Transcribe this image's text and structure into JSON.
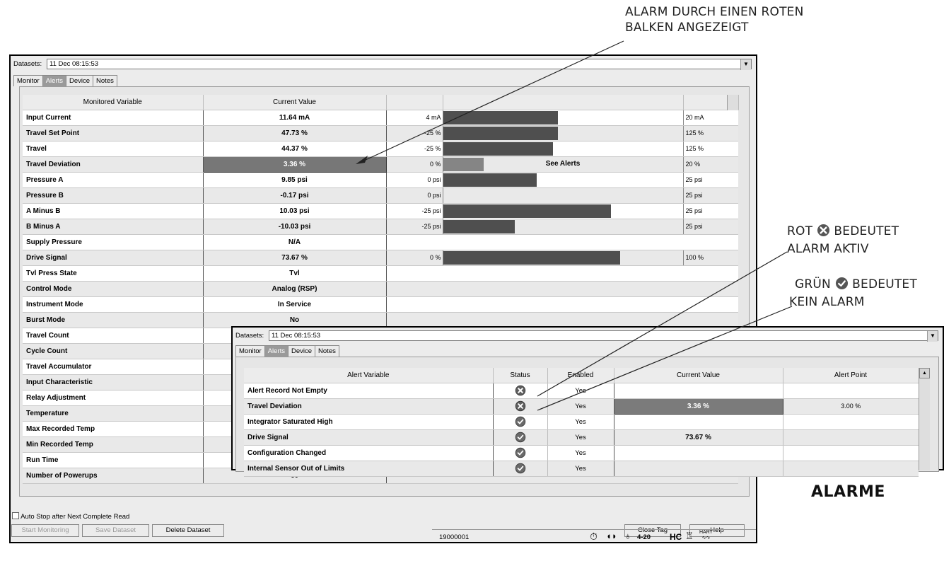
{
  "callouts": {
    "top": [
      "ALARM DURCH EINEN ROTEN",
      "BALKEN ANGEZEIGT"
    ],
    "red": {
      "pre": "ROT",
      "post": "BEDEUTET",
      "line2": "ALARM AKTIV"
    },
    "green": {
      "pre": "GRÜN",
      "post": "BEDEUTET",
      "line2": "KEIN ALARM"
    },
    "title": "ALARME"
  },
  "monitor": {
    "datasets_label": "Datasets:",
    "dataset_value": "11 Dec  08:15:53",
    "tabs": [
      "Monitor",
      "Alerts",
      "Device",
      "Notes"
    ],
    "selected_tab": "Alerts",
    "headers": [
      "Monitored Variable",
      "Current Value"
    ],
    "rows": [
      {
        "name": "Input Current",
        "value": "11.64 mA",
        "lo": "4 mA",
        "hi": "20 mA",
        "fill": 0.48
      },
      {
        "name": "Travel Set Point",
        "value": "47.73 %",
        "lo": "-25 %",
        "hi": "125 %",
        "fill": 0.48
      },
      {
        "name": "Travel",
        "value": "44.37 %",
        "lo": "-25 %",
        "hi": "125 %",
        "fill": 0.46
      },
      {
        "name": "Travel Deviation",
        "value": "3.36 %",
        "lo": "0 %",
        "hi": "20 %",
        "fill": 0.17,
        "alarm": true,
        "bar_text": "See Alerts"
      },
      {
        "name": "Pressure A",
        "value": "9.85 psi",
        "lo": "0 psi",
        "hi": "25 psi",
        "fill": 0.39
      },
      {
        "name": "Pressure B",
        "value": "-0.17 psi",
        "lo": "0 psi",
        "hi": "25 psi",
        "fill": 0
      },
      {
        "name": "A Minus B",
        "value": "10.03 psi",
        "lo": "-25 psi",
        "hi": "25 psi",
        "fill": 0.7
      },
      {
        "name": "B Minus A",
        "value": "-10.03 psi",
        "lo": "-25 psi",
        "hi": "25 psi",
        "fill": 0.3
      },
      {
        "name": "Supply Pressure",
        "value": "N/A"
      },
      {
        "name": "Drive Signal",
        "value": "73.67 %",
        "lo": "0 %",
        "hi": "100 %",
        "fill": 0.74
      },
      {
        "name": "Tvl Press State",
        "value": "Tvl"
      },
      {
        "name": "Control Mode",
        "value": "Analog (RSP)"
      },
      {
        "name": "Instrument Mode",
        "value": "In Service"
      },
      {
        "name": "Burst Mode",
        "value": "No"
      },
      {
        "name": "Travel Count",
        "value": ""
      },
      {
        "name": "Cycle Count",
        "value": ""
      },
      {
        "name": "Travel Accumulator",
        "value": ""
      },
      {
        "name": "Input Characteristic",
        "value": ""
      },
      {
        "name": "Relay Adjustment",
        "value": ""
      },
      {
        "name": "Temperature",
        "value": ""
      },
      {
        "name": "Max Recorded Temp",
        "value": ""
      },
      {
        "name": "Min Recorded Temp",
        "value": ""
      },
      {
        "name": "Run Time",
        "value": ""
      },
      {
        "name": "Number of Powerups",
        "value": "60"
      }
    ],
    "auto_stop": "Auto Stop after Next Complete Read",
    "buttons": {
      "start": "Start Monitoring",
      "save": "Save Dataset",
      "delete": "Delete Dataset",
      "close": "Close Tag",
      "help": "Help"
    },
    "status_id": "19000001",
    "status_loop": "4-20",
    "status_hc": "HC",
    "status_hart": "HART"
  },
  "alerts": {
    "datasets_label": "Datasets:",
    "dataset_value": "11 Dec  08:15:53",
    "tabs": [
      "Monitor",
      "Alerts",
      "Device",
      "Notes"
    ],
    "headers": [
      "Alert Variable",
      "Status",
      "Enabled",
      "Current Value",
      "Alert Point"
    ],
    "rows": [
      {
        "name": "Alert Record Not Empty",
        "status": "red",
        "enabled": "Yes",
        "current": "",
        "point": ""
      },
      {
        "name": "Travel Deviation",
        "status": "red",
        "enabled": "Yes",
        "current": "3.36 %",
        "point": "3.00 %",
        "alarm": true
      },
      {
        "name": "Integrator Saturated High",
        "status": "green",
        "enabled": "Yes",
        "current": "",
        "point": ""
      },
      {
        "name": "Drive Signal",
        "status": "green",
        "enabled": "Yes",
        "current": "73.67 %",
        "point": ""
      },
      {
        "name": "Configuration Changed",
        "status": "green",
        "enabled": "Yes",
        "current": "",
        "point": ""
      },
      {
        "name": "Internal Sensor Out of Limits",
        "status": "green",
        "enabled": "Yes",
        "current": "",
        "point": ""
      }
    ]
  }
}
